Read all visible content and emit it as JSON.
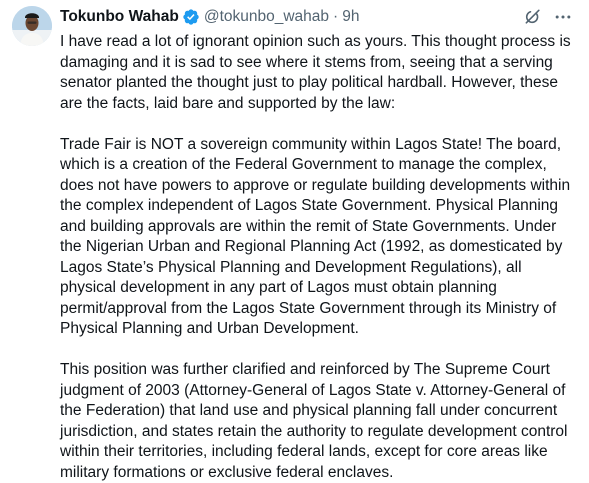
{
  "author": {
    "display_name": "Tokunbo Wahab",
    "handle": "@tokunbo_wahab",
    "separator": "·",
    "timestamp": "9h"
  },
  "icons": {
    "avatar": "profile-photo",
    "verified": "verified-badge-icon",
    "grok": "grok-icon",
    "more": "more-options-icon",
    "accent_color": "#1d9bf0"
  },
  "tweet": {
    "paragraphs": [
      "I have read a lot of ignorant opinion such as yours. This thought process is damaging and it is sad to see where it stems from, seeing that a serving senator planted the thought just to play political hardball. However, these are the facts, laid bare and supported by the law:",
      "Trade Fair is NOT a sovereign community within Lagos State! The board, which is a creation of the Federal Government to manage the complex, does not have powers to approve or regulate building developments within the complex independent of Lagos State Government. Physical Planning and building approvals are within the remit of State Governments. Under the Nigerian Urban and Regional Planning Act (1992, as domesticated by Lagos State’s Physical Planning and Development Regulations), all physical development in any part of Lagos must obtain planning permit/approval from the Lagos  State Government through its Ministry of Physical Planning and Urban Development.",
      "This position was further clarified and reinforced by The Supreme Court judgment of 2003 (Attorney-General of Lagos State v. Attorney-General of the Federation) that land use and physical planning fall under concurrent jurisdiction, and states retain the authority to regulate development control within their territories, including federal lands, except for core areas like military formations or exclusive federal enclaves."
    ]
  }
}
